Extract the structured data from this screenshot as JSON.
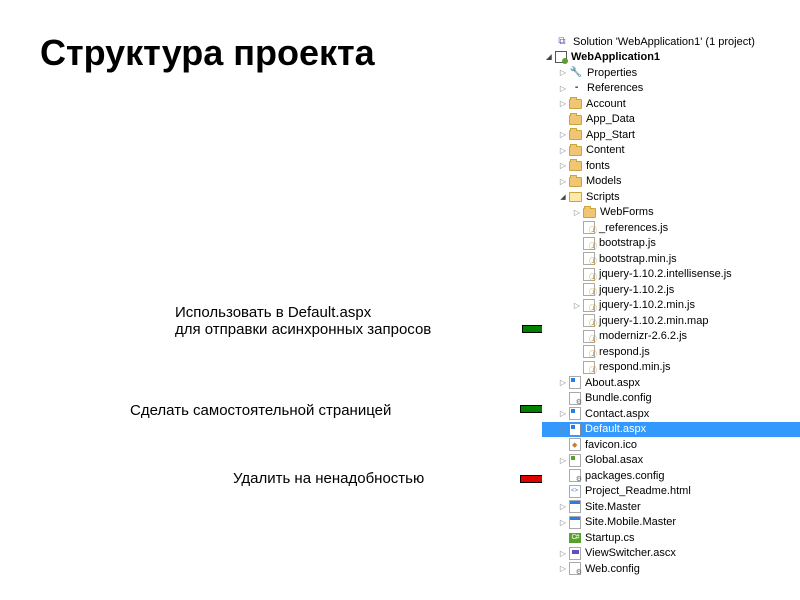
{
  "title": "Структура проекта",
  "annotations": {
    "a1_line1": "Использовать в Default.aspx",
    "a1_line2": "для отправки асинхронных запросов",
    "a2": "Сделать самостоятельной страницей",
    "a3": "Удалить на ненадобностью"
  },
  "tree": {
    "solution": "Solution 'WebApplication1' (1 project)",
    "project": "WebApplication1",
    "properties": "Properties",
    "references": "References",
    "account": "Account",
    "appdata": "App_Data",
    "appstart": "App_Start",
    "content": "Content",
    "fonts": "fonts",
    "models": "Models",
    "scripts": "Scripts",
    "webforms": "WebForms",
    "refjs": "_references.js",
    "bootstrap": "bootstrap.js",
    "bootstrapmin": "bootstrap.min.js",
    "jqintel": "jquery-1.10.2.intellisense.js",
    "jq": "jquery-1.10.2.js",
    "jqmin": "jquery-1.10.2.min.js",
    "jqmap": "jquery-1.10.2.min.map",
    "modernizr": "modernizr-2.6.2.js",
    "respond": "respond.js",
    "respondmin": "respond.min.js",
    "about": "About.aspx",
    "bundle": "Bundle.config",
    "contact": "Contact.aspx",
    "default": "Default.aspx",
    "favicon": "favicon.ico",
    "global": "Global.asax",
    "packages": "packages.config",
    "readme": "Project_Readme.html",
    "sitemaster": "Site.Master",
    "sitemobile": "Site.Mobile.Master",
    "startup": "Startup.cs",
    "viewswitcher": "ViewSwitcher.ascx",
    "webconfig": "Web.config"
  }
}
